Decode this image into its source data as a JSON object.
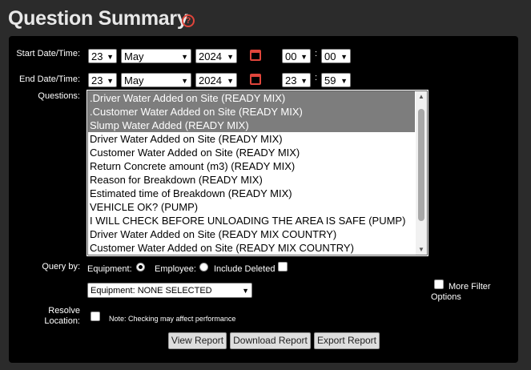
{
  "page": {
    "title": "Question Summary"
  },
  "start": {
    "label": "Start Date/Time:",
    "day": "23",
    "month": "May",
    "year": "2024",
    "hour": "00",
    "minute": "00"
  },
  "end": {
    "label": "End Date/Time:",
    "day": "23",
    "month": "May",
    "year": "2024",
    "hour": "23",
    "minute": "59"
  },
  "time_sep": ":",
  "questions": {
    "label": "Questions:",
    "options": [
      {
        "text": ".Driver Water Added on Site (READY MIX)",
        "selected": true
      },
      {
        "text": ".Customer Water Added on Site (READY MIX)",
        "selected": true
      },
      {
        "text": "Slump Water Added (READY MIX)",
        "selected": true
      },
      {
        "text": "Driver Water Added on Site (READY MIX)",
        "selected": false
      },
      {
        "text": "Customer Water Added on Site (READY MIX)",
        "selected": false
      },
      {
        "text": "Return Concrete amount (m3) (READY MIX)",
        "selected": false
      },
      {
        "text": "Reason for Breakdown (READY MIX)",
        "selected": false
      },
      {
        "text": "Estimated time of Breakdown (READY MIX)",
        "selected": false
      },
      {
        "text": "VEHICLE OK? (PUMP)",
        "selected": false
      },
      {
        "text": "I WILL CHECK BEFORE UNLOADING THE AREA IS SAFE (PUMP)",
        "selected": false
      },
      {
        "text": "Driver Water Added on Site (READY MIX COUNTRY)",
        "selected": false
      },
      {
        "text": "Customer Water Added on Site (READY MIX COUNTRY)",
        "selected": false
      }
    ]
  },
  "query": {
    "label": "Query by:",
    "equipment": "Equipment:",
    "employee": "Employee:",
    "include_deleted": "Include Deleted",
    "selected": "equipment"
  },
  "equipment_select": {
    "value": "Equipment: NONE SELECTED"
  },
  "more_filter": {
    "label": "More Filter Options"
  },
  "resolve": {
    "label": "Resolve Location:",
    "note": "Note: Checking may affect performance"
  },
  "buttons": {
    "view": "View Report",
    "download": "Download Report",
    "export": "Export Report"
  },
  "colors": {
    "accent": "#e0453b",
    "panel": "#000000",
    "background": "#2b2b2b",
    "selected_option": "#7d7d7d"
  }
}
